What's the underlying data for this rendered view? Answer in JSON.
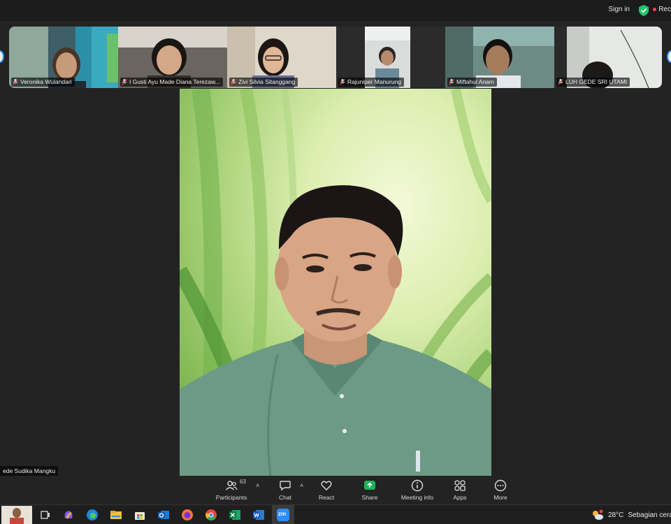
{
  "topbar": {
    "sign_in": "Sign in",
    "recording": "Rec"
  },
  "gallery": {
    "participants": [
      {
        "name": "Veronika Wulandari",
        "muted": true
      },
      {
        "name": "I Gusti Ayu Made Diana Terezaw...",
        "muted": true
      },
      {
        "name": "Zivi Silvia Sitanggang",
        "muted": true
      },
      {
        "name": "Rajuniper Manurung",
        "muted": true
      },
      {
        "name": "Miftahul Anam",
        "muted": true
      },
      {
        "name": "LUH GEDE SRI UTAMI",
        "muted": true
      }
    ]
  },
  "self_view": {
    "name": "ede Sudika Mangku"
  },
  "controls": {
    "participants": {
      "label": "Participants",
      "count": "63"
    },
    "chat": {
      "label": "Chat"
    },
    "react": {
      "label": "React"
    },
    "share": {
      "label": "Share"
    },
    "meeting_info": {
      "label": "Meeting info"
    },
    "apps": {
      "label": "Apps"
    },
    "more": {
      "label": "More"
    }
  },
  "taskbar": {
    "zoom_label": "zm",
    "weather_temp": "28°C",
    "weather_desc": "Sebagian cerah"
  },
  "colors": {
    "accent": "#2d8cff",
    "share": "#1fb25a",
    "mute": "#e5484d",
    "background": "#232323"
  }
}
